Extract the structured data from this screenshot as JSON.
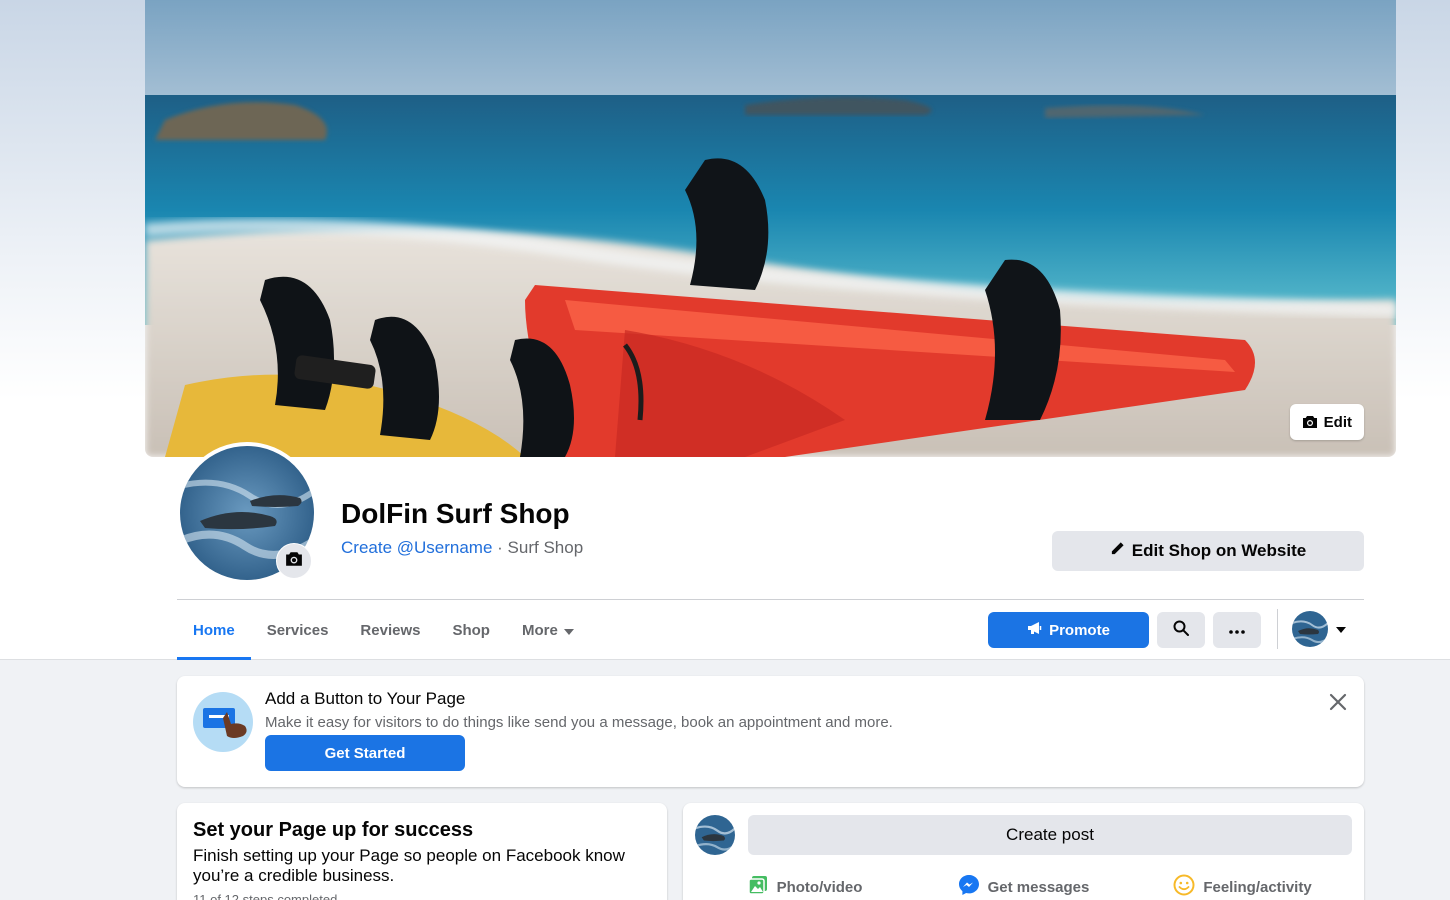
{
  "cover": {
    "edit_label": "Edit"
  },
  "page": {
    "name": "DolFin Surf Shop",
    "username_link": "Create @Username",
    "separator": " · ",
    "category": "Surf Shop",
    "edit_shop_label": "Edit Shop on Website"
  },
  "nav": {
    "tabs": [
      {
        "label": "Home",
        "active": true
      },
      {
        "label": "Services"
      },
      {
        "label": "Reviews"
      },
      {
        "label": "Shop"
      },
      {
        "label": "More"
      }
    ],
    "promote_label": "Promote"
  },
  "add_button_card": {
    "title": "Add a Button to Your Page",
    "description": "Make it easy for visitors to do things like send you a message, book an appointment and more.",
    "cta_label": "Get Started"
  },
  "success_card": {
    "title": "Set your Page up for success",
    "description": "Finish setting up your Page so people on Facebook know you’re a credible business.",
    "steps": "11 of 12 steps completed"
  },
  "create_post": {
    "label": "Create post",
    "actions": [
      {
        "label": "Photo/video",
        "icon": "photo-video-icon"
      },
      {
        "label": "Get messages",
        "icon": "messenger-icon"
      },
      {
        "label": "Feeling/activity",
        "icon": "feeling-icon"
      }
    ]
  },
  "colors": {
    "accent": "#1877f2",
    "button_blue": "#1b74e4",
    "secondary_button": "#e4e6eb",
    "page_bg": "#f0f2f5"
  }
}
